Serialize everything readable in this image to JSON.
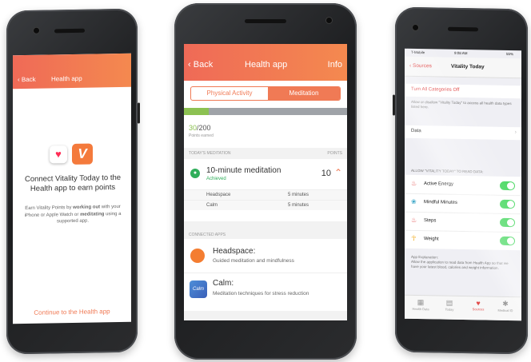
{
  "phone1": {
    "back_label": "Back",
    "title": "Health app",
    "heading": "Connect Vitality Today to the Health app to earn points",
    "body_1": "Earn Vitality Points by ",
    "body_bold_1": "working out",
    "body_2": " with your iPhone or Apple Watch or ",
    "body_bold_2": "meditating",
    "body_3": " using a supported app.",
    "cta": "Continue to the Health app",
    "colors": {
      "accent": "#f07a55",
      "health_icon_bg": "#ffffff",
      "vitality_icon_bg": "#f47a3c"
    }
  },
  "phone2": {
    "back_label": "Back",
    "title": "Health app",
    "info_label": "Info",
    "segments": [
      "Physical Activity",
      "Meditation"
    ],
    "selected_segment": "Meditation",
    "progress": {
      "earned": "30",
      "total": "/200",
      "label": "Points earned",
      "fraction": 0.15
    },
    "todays_header": "TODAY'S MEDITATION",
    "points_header": "POINTS",
    "meditation": {
      "title": "10-minute meditation",
      "status": "Achieved",
      "points": "10",
      "rows": [
        {
          "app": "Headspace",
          "duration": "5 minutes"
        },
        {
          "app": "Calm",
          "duration": "5 minutes"
        }
      ]
    },
    "connected_header": "CONNECTED APPS",
    "apps": [
      {
        "name": "Headspace:",
        "desc": "Guided meditation and mindfulness"
      },
      {
        "name": "Calm:",
        "desc": "Meditation techniques for stress reduction"
      }
    ],
    "calm_logo": "Calm"
  },
  "phone3": {
    "carrier": "T-Mobile",
    "time": "9:08 AM",
    "battery": "55%",
    "back_label": "Sources",
    "title": "Vitality Today",
    "turn_off": "Turn All Categories Off",
    "allow_text": "Allow or disallow \"Vitality Today\" to access all health data types listed here.",
    "data_label": "Data",
    "read_header": "ALLOW \"VITALITY TODAY\" TO READ DATA:",
    "items": [
      {
        "label": "Active Energy",
        "icon": "flame-icon"
      },
      {
        "label": "Mindful Minutes",
        "icon": "lotus-icon"
      },
      {
        "label": "Steps",
        "icon": "flame-icon"
      },
      {
        "label": "Weight",
        "icon": "person-icon"
      }
    ],
    "explanation_title": "App Explanation:",
    "explanation": "Allow the application to read data from Health App so that we have your latest blood, calories and weight information.",
    "tabs": [
      "Health Data",
      "Today",
      "Sources",
      "Medical ID"
    ]
  }
}
